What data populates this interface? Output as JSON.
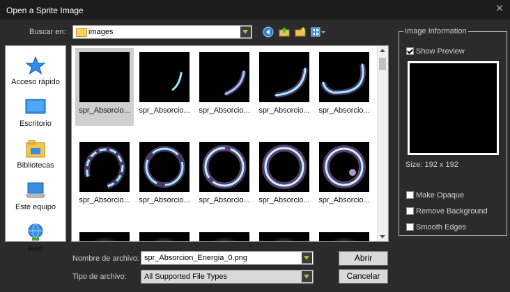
{
  "window": {
    "title": "Open a Sprite Image"
  },
  "lookin": {
    "label": "Buscar en:",
    "value": "images"
  },
  "places": [
    {
      "label": "Acceso rápido",
      "icon": "star-icon"
    },
    {
      "label": "Escritorio",
      "icon": "desktop-icon"
    },
    {
      "label": "Bibliotecas",
      "icon": "libraries-icon"
    },
    {
      "label": "Este equipo",
      "icon": "computer-icon"
    },
    {
      "label": "Red",
      "icon": "network-icon"
    }
  ],
  "files": [
    {
      "name": "spr_Absorcio..."
    },
    {
      "name": "spr_Absorcio..."
    },
    {
      "name": "spr_Absorcio..."
    },
    {
      "name": "spr_Absorcio..."
    },
    {
      "name": "spr_Absorcio..."
    },
    {
      "name": "spr_Absorcio..."
    },
    {
      "name": "spr_Absorcio..."
    },
    {
      "name": "spr_Absorcio..."
    },
    {
      "name": "spr_Absorcio..."
    },
    {
      "name": "spr_Absorcio..."
    },
    {
      "name": ""
    },
    {
      "name": ""
    },
    {
      "name": ""
    },
    {
      "name": ""
    },
    {
      "name": ""
    }
  ],
  "filename": {
    "label": "Nombre de archivo:",
    "value": "spr_Absorcion_Energia_0.png"
  },
  "filetype": {
    "label": "Tipo de archivo:",
    "value": "All Supported File Types"
  },
  "buttons": {
    "open": "Abrir",
    "cancel": "Cancelar"
  },
  "info": {
    "title": "Image Information",
    "show_preview": {
      "label": "Show Preview",
      "checked": true
    },
    "size": "Size: 192 x 192",
    "make_opaque": {
      "label": "Make Opaque",
      "checked": false
    },
    "remove_background": {
      "label": "Remove Background",
      "checked": false
    },
    "smooth_edges": {
      "label": "Smooth Edges",
      "checked": false
    }
  },
  "colors": {
    "background": "#2b2b2b",
    "accent_green": "#8bd02e"
  }
}
